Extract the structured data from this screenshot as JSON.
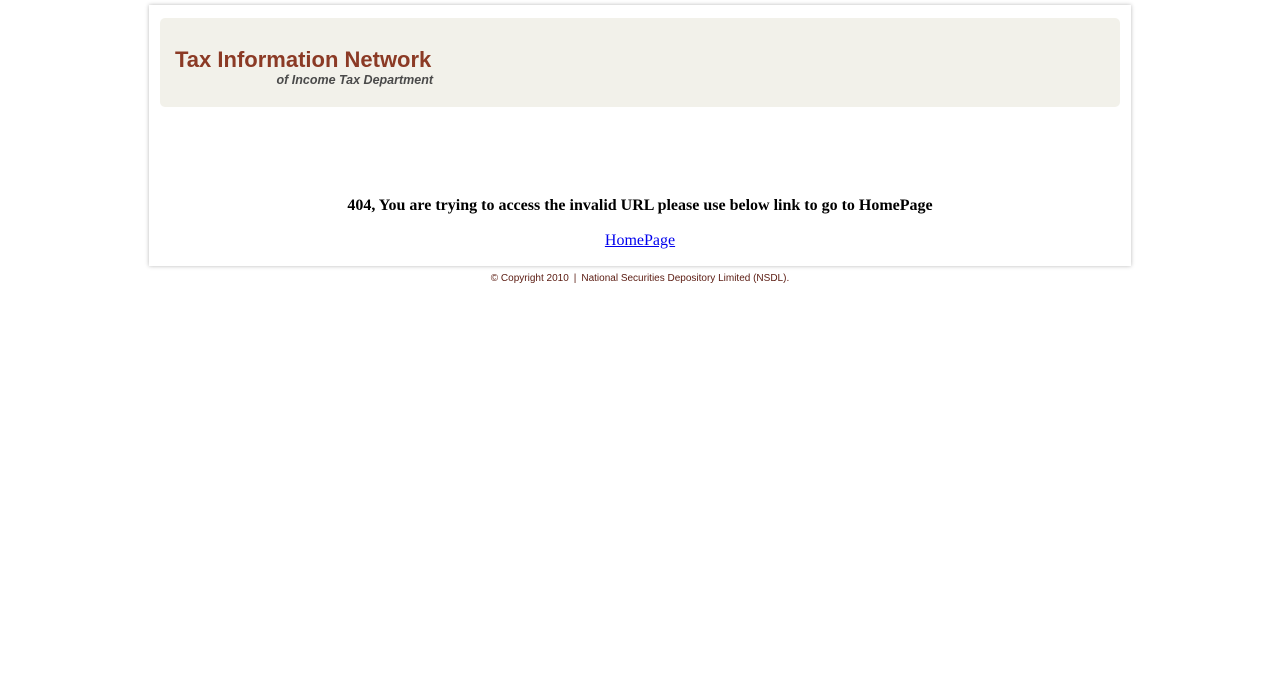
{
  "header": {
    "title": "Tax Information Network",
    "subtitle": "of Income Tax Department"
  },
  "main": {
    "error_message": "404, You are trying to access the invalid URL please use below link to go to HomePage",
    "homepage_link": "HomePage"
  },
  "footer": {
    "copyright": "© Copyright 2010",
    "separator": "|",
    "organization": "National Securities Depository Limited (NSDL)."
  },
  "colors": {
    "brand": "#8b3a25",
    "banner_bg": "#f2f1ea",
    "link": "#0000ee",
    "footer_text": "#5a1a10"
  }
}
